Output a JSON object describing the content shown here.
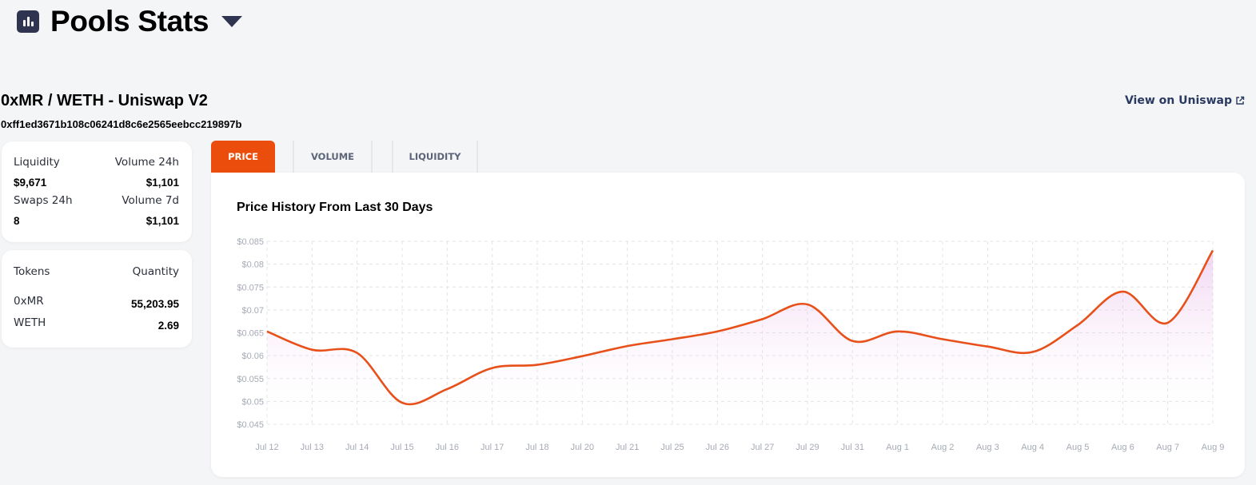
{
  "header": {
    "title": "Pools Stats",
    "icon": "bar-chart-icon",
    "dropdown_icon": "caret-down-icon"
  },
  "pool": {
    "title": "0xMR / WETH - Uniswap V2",
    "address": "0xff1ed3671b108c06241d8c6e2565eebcc219897b",
    "view_link": "View on Uniswap",
    "view_link_icon": "external-link-icon"
  },
  "stats": {
    "liquidity_label": "Liquidity",
    "liquidity_value": "$9,671",
    "volume24_label": "Volume 24h",
    "volume24_value": "$1,101",
    "swaps24_label": "Swaps 24h",
    "swaps24_value": "8",
    "volume7_label": "Volume 7d",
    "volume7_value": "$1,101"
  },
  "tokens": {
    "header_tokens": "Tokens",
    "header_quantity": "Quantity",
    "rows": [
      {
        "name": "0xMR",
        "quantity": "55,203.95"
      },
      {
        "name": "WETH",
        "quantity": "2.69"
      }
    ]
  },
  "tabs": [
    {
      "label": "PRICE",
      "active": true
    },
    {
      "label": "VOLUME",
      "active": false
    },
    {
      "label": "LIQUIDITY",
      "active": false
    }
  ],
  "colors": {
    "accent": "#eb4e0c",
    "line": "#e8501a",
    "area": "#e6b3e6",
    "dark": "#2f3550"
  },
  "chart_data": {
    "type": "area",
    "title": "Price History From Last 30 Days",
    "x": [
      "Jul 12",
      "Jul 13",
      "Jul 14",
      "Jul 15",
      "Jul 16",
      "Jul 17",
      "Jul 18",
      "Jul 20",
      "Jul 21",
      "Jul 25",
      "Jul 26",
      "Jul 27",
      "Jul 29",
      "Jul 31",
      "Aug 1",
      "Aug 2",
      "Aug 3",
      "Aug 4",
      "Aug 5",
      "Aug 6",
      "Aug 7",
      "Aug 9"
    ],
    "series": [
      {
        "values": [
          0.0653,
          0.0613,
          0.0606,
          0.0497,
          0.0527,
          0.0573,
          0.058,
          0.0599,
          0.0621,
          0.0636,
          0.0653,
          0.068,
          0.0712,
          0.0632,
          0.0653,
          0.0636,
          0.062,
          0.0608,
          0.0667,
          0.074,
          0.0672,
          0.083
        ]
      }
    ],
    "yticks": [
      "$0.045",
      "$0.05",
      "$0.055",
      "$0.06",
      "$0.065",
      "$0.07",
      "$0.075",
      "$0.08",
      "$0.085"
    ],
    "ylim": [
      0.045,
      0.085
    ],
    "grid": true,
    "legend": "none"
  }
}
